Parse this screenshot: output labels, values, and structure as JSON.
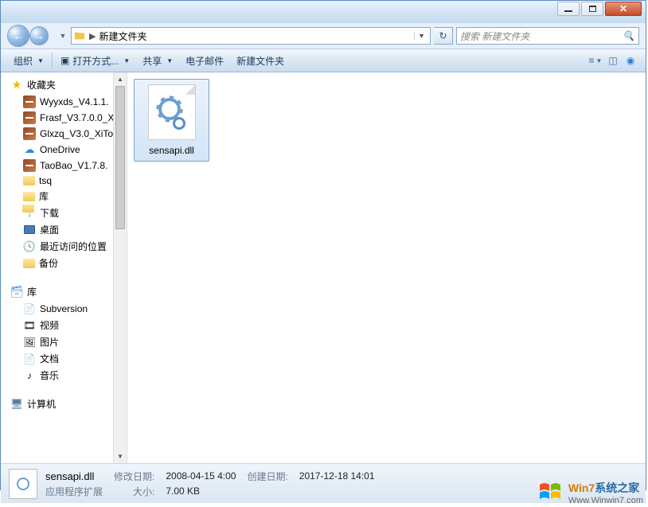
{
  "address": {
    "sep": "▶",
    "path": "新建文件夹",
    "search_placeholder": "搜索 新建文件夹"
  },
  "toolbar": {
    "organize": "组织",
    "open_with": "打开方式...",
    "share": "共享",
    "email": "电子邮件",
    "new_folder": "新建文件夹"
  },
  "sidebar": {
    "favorites": {
      "label": "收藏夹",
      "items": [
        {
          "label": "Wyyxds_V4.1.1.",
          "icon": "rar"
        },
        {
          "label": "Frasf_V3.7.0.0_X",
          "icon": "rar"
        },
        {
          "label": "Glxzq_V3.0_XiTo",
          "icon": "rar"
        },
        {
          "label": "OneDrive",
          "icon": "onedrive"
        },
        {
          "label": "TaoBao_V1.7.8.",
          "icon": "rar"
        },
        {
          "label": "tsq",
          "icon": "folder"
        },
        {
          "label": "库",
          "icon": "folder"
        },
        {
          "label": "下载",
          "icon": "dl"
        },
        {
          "label": "桌面",
          "icon": "desk"
        },
        {
          "label": "最近访问的位置",
          "icon": "recent"
        },
        {
          "label": "备份",
          "icon": "folder"
        }
      ]
    },
    "libraries": {
      "label": "库",
      "items": [
        {
          "label": "Subversion",
          "icon": "doc"
        },
        {
          "label": "视频",
          "icon": "doc"
        },
        {
          "label": "图片",
          "icon": "doc"
        },
        {
          "label": "文档",
          "icon": "doc"
        },
        {
          "label": "音乐",
          "icon": "doc"
        }
      ]
    },
    "computer": {
      "label": "计算机"
    }
  },
  "file": {
    "name": "sensapi.dll"
  },
  "status": {
    "name": "sensapi.dll",
    "type": "应用程序扩展",
    "mod_label": "修改日期:",
    "mod_val": "2008-04-15 4:00",
    "size_label": "大小:",
    "size_val": "7.00 KB",
    "create_label": "创建日期:",
    "create_val": "2017-12-18 14:01"
  },
  "watermark": {
    "t1": "Win7",
    "t2": "系统之家",
    "url": "Www.Winwin7.com"
  }
}
